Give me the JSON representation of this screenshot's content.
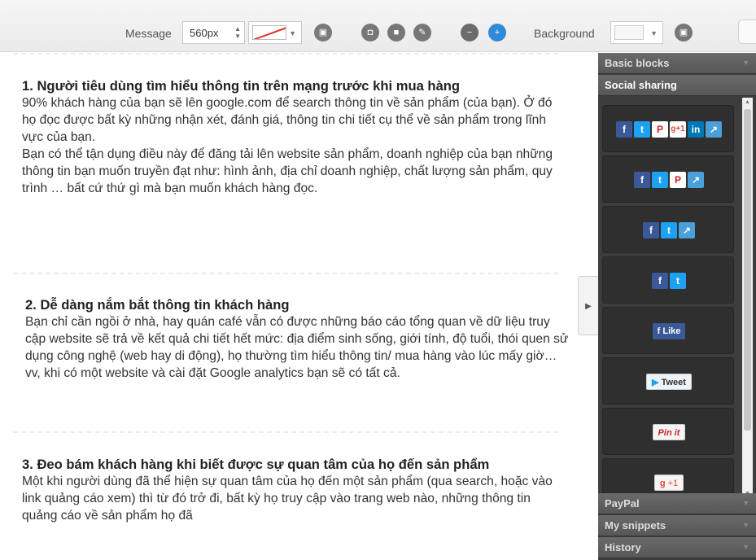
{
  "toolbar": {
    "message_label": "Message",
    "width_value": "560px",
    "background_label": "Background",
    "icons": [
      "image-icon",
      "fit-icon",
      "fill-icon",
      "wand-icon",
      "remove-icon",
      "add-icon",
      "bg-image-icon"
    ],
    "accent_color": "#2f8ad8"
  },
  "content": {
    "sections": [
      {
        "title": "1. Người tiêu dùng tìm hiểu thông tin trên mạng trước khi mua hàng",
        "paragraphs": [
          "90% khách hàng của bạn sẽ lên google.com để search thông tin về sản phẩm (của bạn). Ở đó họ đọc được bất kỳ những nhận xét, đánh giá, thông tin chi tiết cụ thể về sản phẩm trong lĩnh vực của bạn.",
          "Bạn có thể tận dụng điều này để đăng tải lên website sản phẩm, doanh nghiệp của bạn những thông tin bạn muốn truyền đạt như: hình ảnh, địa chỉ doanh nghiệp, chất lượng sản phẩm, quy trình … bất cứ thứ gì mà bạn muốn khách hàng đọc."
        ]
      },
      {
        "title": "2. Dễ dàng nắm bắt thông tin khách hàng",
        "paragraphs": [
          "Bạn chỉ cần ngồi ở nhà, hay quán café vẫn có được những báo cáo tổng quan về dữ liệu truy cập website sẽ trả về kết quả chi tiết hết mức: địa điểm sinh sống, giới tính, độ tuổi, thói quen sử dụng công nghệ (web hay di động), họ thường tìm hiểu thông tin/ mua hàng vào lúc mấy giờ… vv, khi có một website và cài đặt Google analytics bạn sẽ có tất cả."
        ]
      },
      {
        "title": "3. Đeo bám khách hàng khi biết được sự quan tâm của họ đến sản phẩm",
        "paragraphs": [
          "Một khi người dùng đã thể hiện sự quan tâm của họ đến một sản phẩm (qua search, hoặc vào link quảng cáo xem) thì từ đó trở đi, bất kỳ họ truy cập vào trang web nào, những thông tin quảng cáo về sản phẩm họ đã"
        ]
      }
    ]
  },
  "sidebar": {
    "headers": {
      "basic": "Basic blocks",
      "social": "Social sharing",
      "paypal": "PayPal",
      "snippets": "My snippets",
      "history": "History"
    },
    "social": {
      "fb_glyph": "f",
      "tw_glyph": "t",
      "pi_glyph": "P",
      "gp_glyph": "g+1",
      "li_glyph": "in",
      "sh_glyph": "↗",
      "like_label": "Like",
      "tweet_label": "Tweet",
      "pinit_label": "Pin it",
      "gplus_count": "+1"
    }
  }
}
